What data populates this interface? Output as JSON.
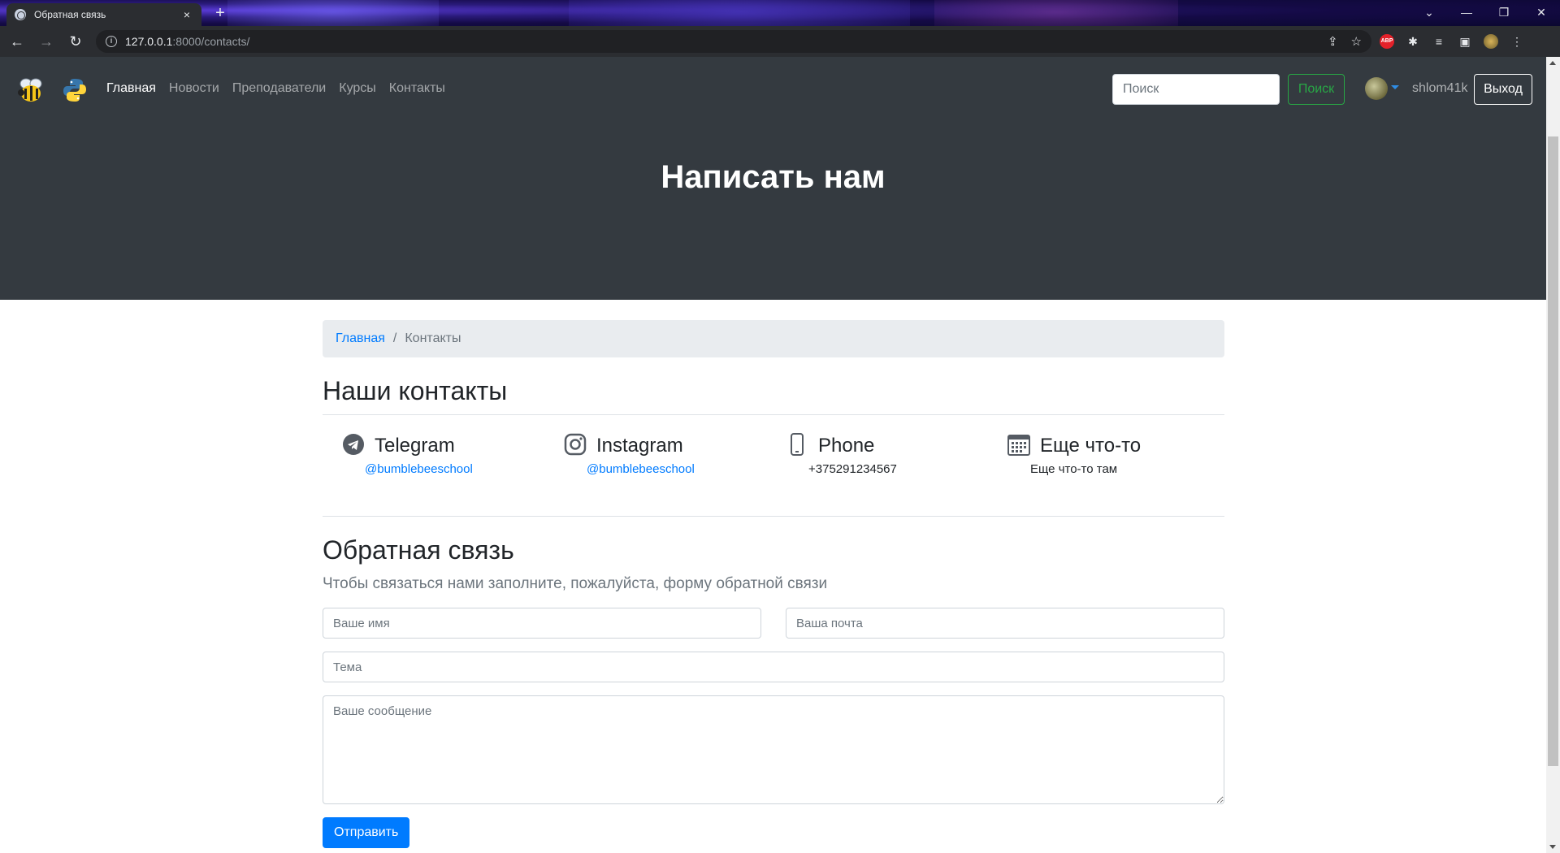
{
  "browser": {
    "tab_title": "Обратная связь",
    "tab_close": "×",
    "new_tab": "+",
    "url_host": "127.0.0.1",
    "url_path": ":8000/contacts/",
    "window_controls": [
      "⌄",
      "—",
      "❐",
      "✕"
    ]
  },
  "navbar": {
    "links": [
      {
        "label": "Главная",
        "active": true
      },
      {
        "label": "Новости",
        "active": false
      },
      {
        "label": "Преподаватели",
        "active": false
      },
      {
        "label": "Курсы",
        "active": false
      },
      {
        "label": "Контакты",
        "active": false
      }
    ],
    "search_placeholder": "Поиск",
    "search_button": "Поиск",
    "username": "shlom41k",
    "logout": "Выход"
  },
  "hero": {
    "title": "Написать нам"
  },
  "breadcrumb": {
    "home": "Главная",
    "separator": "/",
    "current": "Контакты"
  },
  "contacts": {
    "title": "Наши контакты",
    "items": [
      {
        "icon": "telegram-icon",
        "title": "Telegram",
        "value": "@bumblebeeschool",
        "is_link": true
      },
      {
        "icon": "instagram-icon",
        "title": "Instagram",
        "value": "@bumblebeeschool",
        "is_link": true
      },
      {
        "icon": "phone-icon",
        "title": "Phone",
        "value": "+375291234567",
        "is_link": false
      },
      {
        "icon": "calendar-icon",
        "title": "Еще что-то",
        "value": "Еще что-то там",
        "is_link": false
      }
    ]
  },
  "feedback": {
    "title": "Обратная связь",
    "lead": "Чтобы связаться нами заполните, пожалуйста, форму обратной связи",
    "name_placeholder": "Ваше имя",
    "email_placeholder": "Ваша почта",
    "subject_placeholder": "Тема",
    "message_placeholder": "Ваше сообщение",
    "submit": "Отправить"
  },
  "colors": {
    "header_bg": "#343a40",
    "link": "#007bff",
    "success": "#28a745",
    "breadcrumb_bg": "#e9ecef"
  }
}
